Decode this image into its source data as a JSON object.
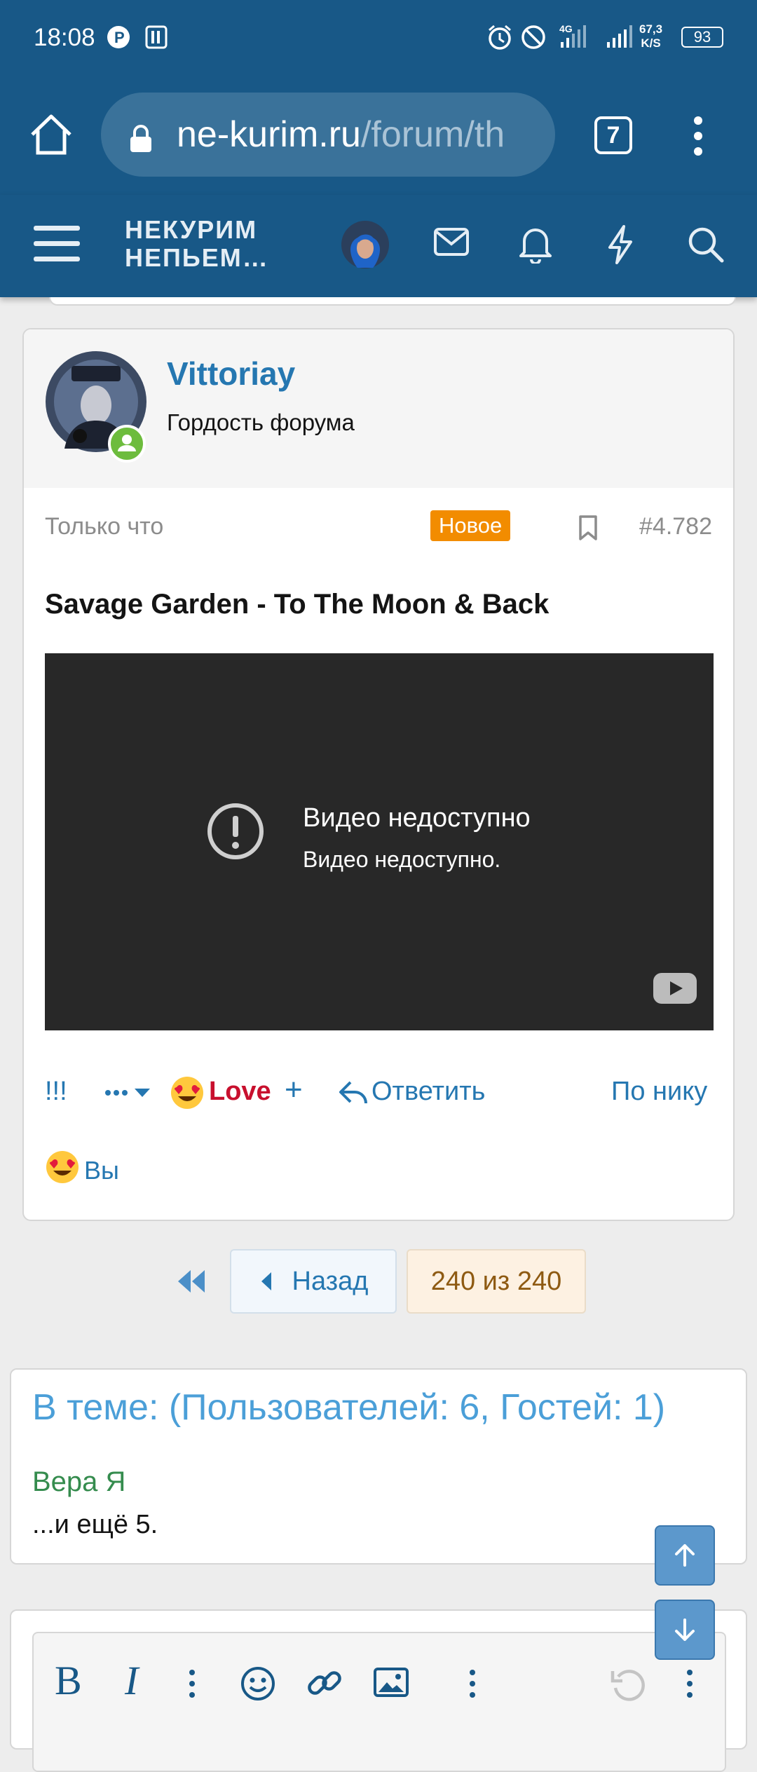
{
  "status_bar": {
    "time": "18:08",
    "net_speed_value": "67,3",
    "net_speed_unit": "K/S",
    "battery": "93"
  },
  "browser": {
    "url_host": "ne-kurim.ru",
    "url_path": "/forum/th",
    "tab_count": "7"
  },
  "forum": {
    "brand_line1": "НЕКУРИМ",
    "brand_line2": "НЕПЬЕМ…"
  },
  "post": {
    "username": "Vittoriay",
    "user_title": "Гордость форума",
    "time": "Только что",
    "new_badge": "Новое",
    "post_number": "#4.782",
    "title": "Savage Garden - To The Moon & Back",
    "video_error_title": "Видео недоступно",
    "video_error_subtitle": "Видео недоступно.",
    "actions": {
      "exclaim": "!!!",
      "love": "Love",
      "plus": "+",
      "reply": "Ответить",
      "by_nick": "По нику"
    },
    "reactions_you": "Вы"
  },
  "pagination": {
    "back": "Назад",
    "page_label": "240 из 240"
  },
  "in_topic": {
    "header": "В теме: (Пользователей: 6, Гостей: 1)",
    "user": "Вера Я",
    "more": "...и ещё 5."
  },
  "editor": {
    "bold": "B",
    "italic": "I"
  },
  "colors": {
    "brand_blue": "#185887",
    "link_blue": "#2577b1",
    "badge_orange": "#f28c00",
    "love_red": "#c8102e"
  }
}
